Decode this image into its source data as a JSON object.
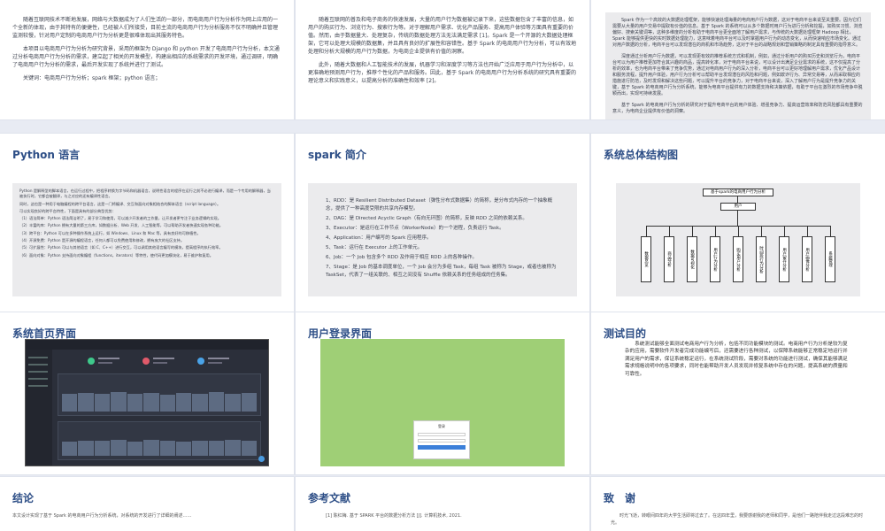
{
  "row0": {
    "s1": {
      "paras": [
        "随着互联网技术不断地发展，网络与大数据成为了人们生活的一部分，而电商用户行为分析作为网上应用的一个全新的体现，由于其特有的便捷性，已经被人们所接受，目前主流的电商用户行为分析服务不仅不明确并且管理监测较慢，针对用户定制的电商用户行为分析更是很难体现出其服务特色。",
        "本项目以电商用户行为分析为研究背景，采用的框架为 Django 和 python 开发了电商用户行为分析，本文通过分析电商用户行为分析的需求，建立起了相关的开发模型，构建出相应的系统需求的开发环境，通过调研，明确了电商用户行为分析的需求，最后开发实现了系统并进行了测试。",
        "关键词：电商用户行为分析；spark 框架；python 语言；"
      ]
    },
    "s2": {
      "paras": [
        "随着互联网的普及和电子商务的快速发展，大量的用户行为数据被记录下来，这些数据包含了丰富的信息，如用户的购买行为、浏览行为、搜索行为等。对于理解用户需求、优化产品服务、提高用户体验等方面具有重要的价值。然而，由于数据量大、处理复杂，传统的数据处理方法无法满足需求 [1]。Spark 是一个开源的大数据处理框架，它可以处理大规模的数据集，并且具有良好的扩展性和容错性。基于 Spark 的电商用户行为分析，可以有效地处理和分析大规模的用户行为数据，为电商企业提供有价值的洞察。",
        "此外，随着大数据和人工智能技术的发展，机器学习和深度学习等方法也开始广泛应用于用户行为分析中，以更准确地预测用户行为，推荐个性化的产品和服务。因此，基于 Spark 的电商用户行为分析系统的研究具有重要的理论意义和实践意义，以提高分析的准确性和效率 [2]。"
      ]
    },
    "s3": {
      "paras": [
        "Spark 作为一个高效的大数据处理框架，能够快速处理海量的电商用户行为数据，这对于电商平台来说至关重要。因为它们需要从大量的用户交易中提取有价值的信息。基于 Spark 的系统可以从多个数据时用户行为进行分析和挖掘，如购买习惯、浏览偏好、搜索关键词等，这种多维度的分析有助于电商平台更全面地了解用户需求，与传统的大数据处理框架 Hadoop 相比，Spark 能够提供更快的实时数据处理能力，这意味着电商平台可以及时掌握用户行为的动态变化，从而快速响应市场变化。通过对用户数据的分析，电商平台可以发现潜在的商机和市场趋势，这对于平台的战略规划和营销策略的制定具有重要的指导意义。",
        "深度通过分析用户行为数据，可以发现更有效的推荐系统方式和机制，例如，通过分析用户的购买历史和浏览行为，电商平台可以为用户推荐更加符合其兴趣的商品，提高转化率，对于电商平台来说，可以设计出满足企业需求的系统，这不仅提高了分析的效率，也为电商平台带来了竞争优势，通过对电商用户行为的深入分析，电商平台可以更好地理解用户需求，优化产品设计和服务流程，提升用户体验，用户行为分析可以帮助平台发现潜在的风险和问题，例如欺诈行为、异常交易等，从而采取相应的措施进行防范，及时发现和解决这些问题，可以提升平台的竞争力，对于电商平台来说，深入了解用户行为是提升竞争力的关键，基于 Spark 的电商用户行为分析系统，能够为电商平台提供有力的数据支持和决策依据，有助于平台在激烈的市场竞争中脱颖而出，实现可持续发展。",
        "基于 Spark 的电商用户行为分析的研究对于提升电商平台的用户体验、增强竞争力、提高运营效率和防范风险都具有重要的意义，为电商企业提供有价值的洞察。"
      ]
    }
  },
  "row1": {
    "python": {
      "title": "Python 语言",
      "paras": [
        "Python 是解释型的脚本语言，在运行过程中，把程序转换为字节码和机器语言，说明性语言的程序在运行之前不必进行编译，而是一个专用的解释器，当被执行时，它都会被翻译，与之对应的还有编译性语言。",
        "同时，这也是一种用于电脑编程的跨平台语言，这是一门将编译、交互和面向对象相结合的脚本语言（script language）。",
        "可以实现良好的跨平台特性，下面是具有的部分典型优势：",
        "（1）语法简单：Python 语法简洁明了，易于学习和使用，可以减少开发者的工作量，让开发者更专注于业务逻辑的实现。",
        "（2）丰富的库：Python 拥有大量的第三方库，如数据分析、Web 开发、人工智能等，可以帮助开发者快速实现各种功能。",
        "（3）跨平台：Python 可以在多种操作系统上运行，如 Windows、Linux 和 Mac 等，具有良好的可移植性。",
        "（4）开源免费：Python 是开源的编程语言，任何人都可以免费使用和修改，拥有庞大的社区支持。",
        "（5）可扩展性：Python 可以与其他语言（如 C、C++）进行交互，可以调用其他语言编写的模块，提高程序的执行效率。",
        "（6）面向对象：Python 支持面向对象编程（functions，iterators）等特性，使代码更加模块化，易于维护和复用。"
      ]
    },
    "spark": {
      "title": "spark 简介",
      "items": [
        "1、RDD：是 Resilient Distributed Dataset（弹性分布式数据集）的简称，是分布式内存的一个抽象概念，提供了一种高度受限的共享内存模型。",
        "2、DAG：是 Directed Acyclic Graph（有向无环图）的简称，反映 RDD 之间的依赖关系。",
        "3、Executor：是运行在工作节点（WorkerNode）的一个进程，负责运行 Task。",
        "4、Application：用户编写的 Spark 应用程序。",
        "5、Task：运行在 Executor 上的工作单元。",
        "6、Job：一个 Job 包含多个 RDD 及作用于相应 RDD 上的各种操作。",
        "7、Stage：是 Job 的基本调度单位，一个 Job 会分为多组 Task，每组 Task 被称为 Stage，或者也被称为 TaskSet，代表了一组关联的、相互之间没有 Shuffle 依赖关系的任务组成的任务集。"
      ]
    },
    "arch": {
      "title": "系统总体结构图",
      "root": "基于spark的电商用户行为分析",
      "mid": "用户",
      "modules": [
        "数据总览",
        "商品分析",
        "数据可视化",
        "用户行为分析",
        "购买用户分析",
        "时间段行为分析",
        "用户留存分析",
        "用户画像分析",
        "系统管理"
      ]
    }
  },
  "row2": {
    "home": {
      "title": "系统首页界面"
    },
    "login": {
      "title": "用户登录界面",
      "box_title": "登录"
    },
    "test": {
      "title": "测试目的",
      "text": "系统测试能够全面测试电商用户行为分析，包括不同功能模块的测试。电商用户行为分析是较为复杂的应用，需要软件开发者完成功能编写后，还需要进行各种测试，以保障系统能够正常稳定地运行并满足用户的需求，保证系统稳定运行，在系统测试阶段，需要对系统的功能进行测试，确保其能够满足需求规格说明中的各项要求，同时也能帮助开发人员发现并修复系统中存在的问题，提高系统的质量和可靠性。"
    }
  },
  "row3": {
    "conclusion": {
      "title": "结论",
      "text": "本文设计实现了基于 Spark 的电商用户行为分析系统，对系统的开发进行了详细的阐述……"
    },
    "refs": {
      "title": "参考文献",
      "text": "[1] 陈红梅. 基于 SPARK 平台的数据分析方法 [J]. 计算机技术, 2021."
    },
    "thanks": {
      "title": "致　谢",
      "text": "时光飞逝，转眼间四年的大学生活即将过去了。在这四年里，我要感谢我的老师和同学，是他们一路陪伴我走过这段难忘的时光。"
    }
  }
}
